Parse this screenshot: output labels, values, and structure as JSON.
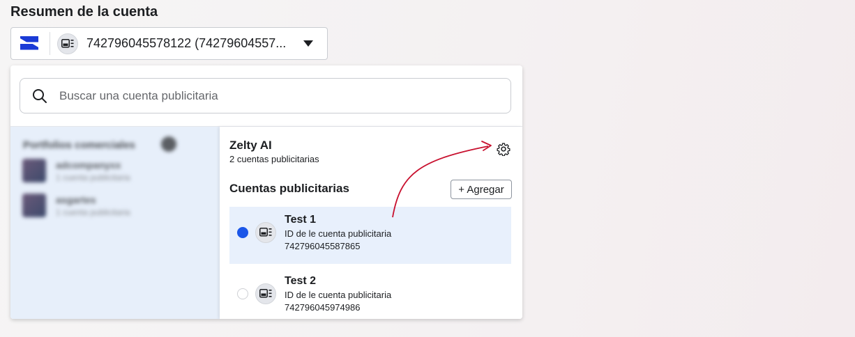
{
  "page": {
    "title": "Resumen de la cuenta"
  },
  "selector": {
    "logo_icon": "brand-logo-icon",
    "ad_icon": "ad-account-icon",
    "value": "742796045578122 (74279604557...",
    "caret_icon": "caret-down-icon"
  },
  "search": {
    "placeholder": "Buscar una cuenta publicitaria",
    "value": "",
    "icon": "search-icon"
  },
  "business": {
    "name": "Zelty AI",
    "count": "2 cuentas publicitarias",
    "settings_icon": "gear-icon"
  },
  "accounts_section": {
    "title": "Cuentas publicitarias",
    "add_label": "+ Agregar",
    "items": [
      {
        "name": "Test 1",
        "id_label": "ID de le cuenta publicitaria",
        "id": "742796045587865",
        "selected": true
      },
      {
        "name": "Test 2",
        "id_label": "ID de le cuenta publicitaria",
        "id": "742796045974986",
        "selected": false
      }
    ]
  },
  "colors": {
    "accent_blue": "#1b56e8",
    "selected_row": "#e8f0fc",
    "left_pane": "#e7effa",
    "annotation_arrow": "#c8102e"
  }
}
